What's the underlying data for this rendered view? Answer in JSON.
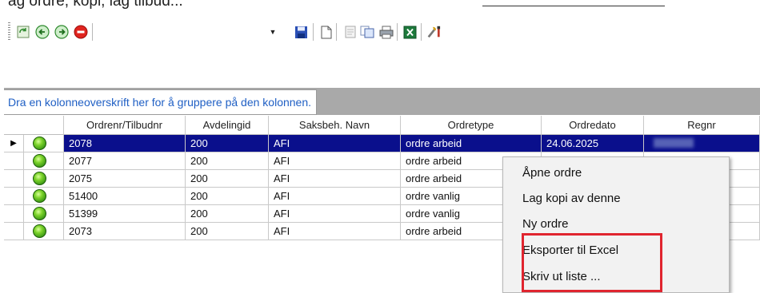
{
  "top_text": {
    "prefix": "ag ordre, kopi, lag tilbud...",
    "link": ""
  },
  "toolbar": {
    "combo_value": "",
    "buttons": [
      {
        "name": "refresh-icon",
        "label": "Oppdater"
      },
      {
        "name": "back-icon",
        "label": "Tilbake"
      },
      {
        "name": "forward-icon",
        "label": "Frem"
      },
      {
        "name": "stop-icon",
        "label": "Stopp"
      },
      {
        "name": "save-icon",
        "label": "Lagre"
      },
      {
        "name": "new-document-icon",
        "label": "Ny"
      },
      {
        "name": "document-icon",
        "label": "Dokument"
      },
      {
        "name": "copy-icon",
        "label": "Kopier"
      },
      {
        "name": "print-icon",
        "label": "Skriv ut"
      },
      {
        "name": "excel-icon",
        "label": "Excel"
      },
      {
        "name": "tools-icon",
        "label": "Verktøy"
      }
    ]
  },
  "group_hint": "Dra en kolonneoverskrift her for å gruppere på den kolonnen.",
  "columns": [
    "",
    "Ordrenr/Tilbudnr",
    "Avdelingid",
    "Saksbeh. Navn",
    "Ordretype",
    "Ordredato",
    "Regnr"
  ],
  "rows": [
    {
      "ordrenr": "2078",
      "avdeling": "200",
      "saksbeh": "AFI",
      "ordretype": "ordre arbeid",
      "ordredato": "24.06.2025",
      "selected": true
    },
    {
      "ordrenr": "2077",
      "avdeling": "200",
      "saksbeh": "AFI",
      "ordretype": "ordre arbeid",
      "ordredato": "",
      "selected": false
    },
    {
      "ordrenr": "2075",
      "avdeling": "200",
      "saksbeh": "AFI",
      "ordretype": "ordre arbeid",
      "ordredato": "",
      "selected": false
    },
    {
      "ordrenr": "51400",
      "avdeling": "200",
      "saksbeh": "AFI",
      "ordretype": "ordre vanlig",
      "ordredato": "",
      "selected": false
    },
    {
      "ordrenr": "51399",
      "avdeling": "200",
      "saksbeh": "AFI",
      "ordretype": "ordre vanlig",
      "ordredato": "",
      "selected": false
    },
    {
      "ordrenr": "2073",
      "avdeling": "200",
      "saksbeh": "AFI",
      "ordretype": "ordre arbeid",
      "ordredato": "",
      "selected": false
    }
  ],
  "context_menu": {
    "items": [
      "Åpne ordre",
      "Lag kopi av denne",
      "Ny ordre",
      "Eksporter til Excel",
      "Skriv ut liste ..."
    ],
    "highlight_color": "#e0252f"
  },
  "colors": {
    "selection": "#0a0f8c",
    "group_panel": "#a9a9a9",
    "hint_text": "#1f5fc4"
  }
}
